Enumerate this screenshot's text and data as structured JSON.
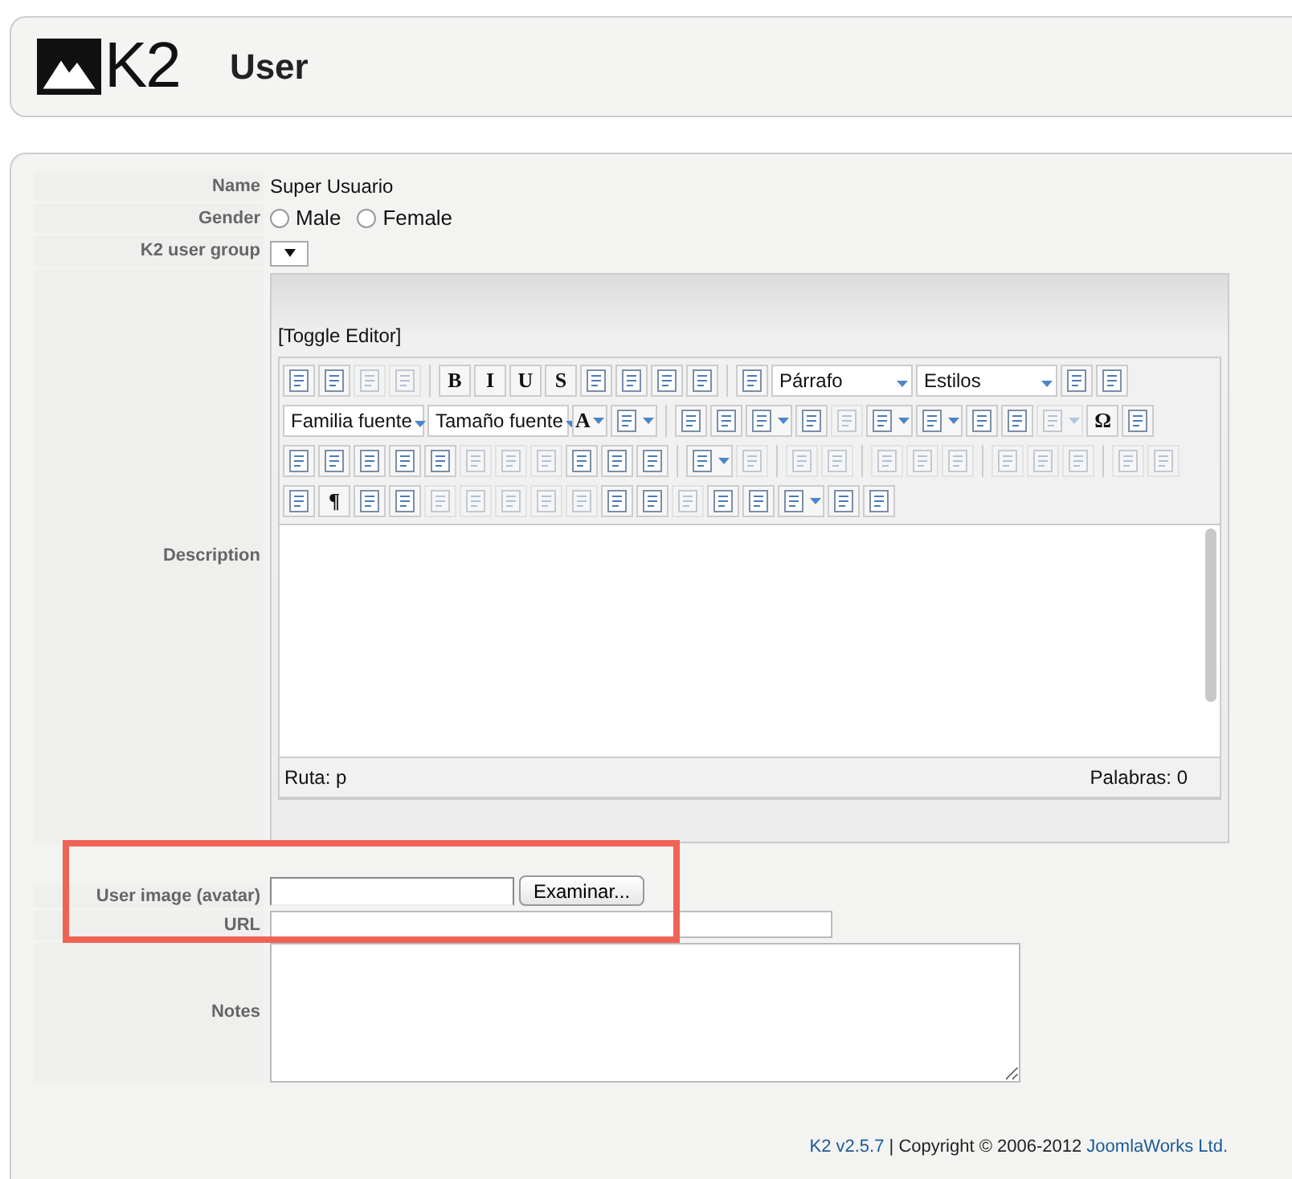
{
  "header": {
    "logo": "K2",
    "title": "User"
  },
  "fields": {
    "name_label": "Name",
    "name_value": "Super Usuario",
    "gender_label": "Gender",
    "gender_options": [
      {
        "label": "Male",
        "selected": false
      },
      {
        "label": "Female",
        "selected": false
      }
    ],
    "group_label": "K2 user group",
    "description_label": "Description",
    "avatar_label": "User image (avatar)",
    "browse_button": "Examinar...",
    "url_label": "URL",
    "notes_label": "Notes"
  },
  "editor": {
    "toggle": "[Toggle Editor]",
    "toolbar_rows": [
      [
        {
          "kind": "button"
        },
        {
          "kind": "button"
        },
        {
          "kind": "button",
          "disabled": true
        },
        {
          "kind": "button",
          "disabled": true
        },
        {
          "kind": "separator"
        },
        {
          "kind": "button",
          "glyph": "B"
        },
        {
          "kind": "button",
          "glyph": "I"
        },
        {
          "kind": "button",
          "glyph": "U"
        },
        {
          "kind": "button",
          "glyph": "S"
        },
        {
          "kind": "button"
        },
        {
          "kind": "button"
        },
        {
          "kind": "button"
        },
        {
          "kind": "button"
        },
        {
          "kind": "separator"
        },
        {
          "kind": "button"
        },
        {
          "kind": "select",
          "label": "Párrafo"
        },
        {
          "kind": "select",
          "label": "Estilos"
        },
        {
          "kind": "button"
        },
        {
          "kind": "button"
        }
      ],
      [
        {
          "kind": "select",
          "label": "Familia fuente"
        },
        {
          "kind": "select",
          "label": "Tamaño fuente"
        },
        {
          "kind": "button",
          "glyph": "A",
          "split": true
        },
        {
          "kind": "button",
          "split": true
        },
        {
          "kind": "separator"
        },
        {
          "kind": "button"
        },
        {
          "kind": "button"
        },
        {
          "kind": "button",
          "split": true
        },
        {
          "kind": "button"
        },
        {
          "kind": "button",
          "disabled": true
        },
        {
          "kind": "button",
          "split": true
        },
        {
          "kind": "button",
          "split": true
        },
        {
          "kind": "button"
        },
        {
          "kind": "button"
        },
        {
          "kind": "button",
          "disabled": true,
          "split": true
        },
        {
          "kind": "button",
          "glyph": "Ω"
        },
        {
          "kind": "button"
        }
      ],
      [
        {
          "kind": "button"
        },
        {
          "kind": "button"
        },
        {
          "kind": "button"
        },
        {
          "kind": "button"
        },
        {
          "kind": "button"
        },
        {
          "kind": "button",
          "disabled": true
        },
        {
          "kind": "button",
          "disabled": true
        },
        {
          "kind": "button",
          "disabled": true
        },
        {
          "kind": "button"
        },
        {
          "kind": "button"
        },
        {
          "kind": "button"
        },
        {
          "kind": "separator"
        },
        {
          "kind": "button",
          "split": true
        },
        {
          "kind": "button",
          "disabled": true
        },
        {
          "kind": "separator"
        },
        {
          "kind": "button",
          "disabled": true
        },
        {
          "kind": "button",
          "disabled": true
        },
        {
          "kind": "separator"
        },
        {
          "kind": "button",
          "disabled": true
        },
        {
          "kind": "button",
          "disabled": true
        },
        {
          "kind": "button",
          "disabled": true
        },
        {
          "kind": "separator"
        },
        {
          "kind": "button",
          "disabled": true
        },
        {
          "kind": "button",
          "disabled": true
        },
        {
          "kind": "button",
          "disabled": true
        },
        {
          "kind": "separator"
        },
        {
          "kind": "button",
          "disabled": true
        },
        {
          "kind": "button",
          "disabled": true
        }
      ],
      [
        {
          "kind": "button"
        },
        {
          "kind": "button",
          "glyph": "¶"
        },
        {
          "kind": "button"
        },
        {
          "kind": "button"
        },
        {
          "kind": "button",
          "disabled": true
        },
        {
          "kind": "button",
          "disabled": true
        },
        {
          "kind": "button",
          "disabled": true
        },
        {
          "kind": "button",
          "disabled": true
        },
        {
          "kind": "button",
          "disabled": true
        },
        {
          "kind": "button"
        },
        {
          "kind": "button"
        },
        {
          "kind": "button",
          "disabled": true
        },
        {
          "kind": "button"
        },
        {
          "kind": "button"
        },
        {
          "kind": "button",
          "split": true
        },
        {
          "kind": "button"
        },
        {
          "kind": "button"
        }
      ]
    ],
    "path": "Ruta:  p",
    "words": "Palabras: 0"
  },
  "footer": {
    "version": "K2 v2.5.7",
    "separator": "| Copyright © 2006-2012",
    "company": "JoomlaWorks Ltd."
  },
  "highlight": {
    "shown": true
  }
}
